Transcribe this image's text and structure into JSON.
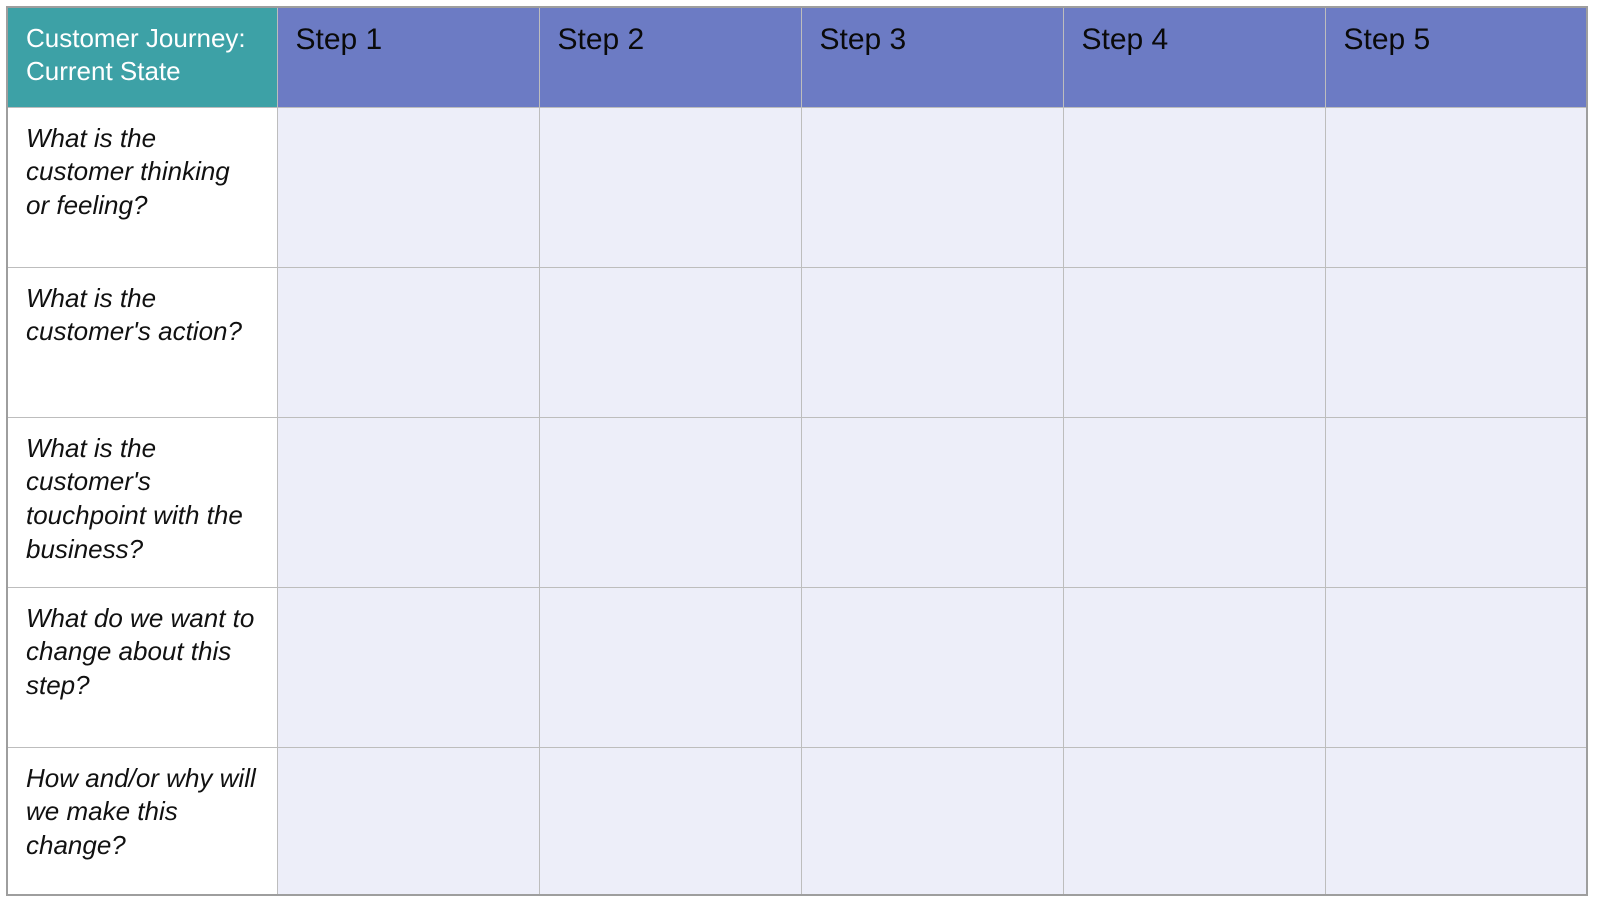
{
  "chart_data": {
    "type": "table",
    "title": "Customer Journey: Current State",
    "columns": [
      "Step 1",
      "Step 2",
      "Step 3",
      "Step 4",
      "Step 5"
    ],
    "rows": [
      "What is the customer thinking or feeling?",
      "What is the customer's action?",
      "What is the customer's touchpoint with the business?",
      "What do we want to change about this step?",
      "How and/or why will we make this change?"
    ],
    "cells": [
      [
        "",
        "",
        "",
        "",
        ""
      ],
      [
        "",
        "",
        "",
        "",
        ""
      ],
      [
        "",
        "",
        "",
        "",
        ""
      ],
      [
        "",
        "",
        "",
        "",
        ""
      ],
      [
        "",
        "",
        "",
        "",
        ""
      ]
    ]
  },
  "table": {
    "corner_label": "Customer Journey: Current State",
    "steps": [
      "Step 1",
      "Step 2",
      "Step 3",
      "Step 4",
      "Step 5"
    ],
    "row_labels": [
      "What is the customer thinking or feeling?",
      "What is the customer's action?",
      "What is the customer's touchpoint with the business?",
      "What do we want to change about this step?",
      "How and/or why will we make this change?"
    ],
    "cells": {
      "r0": [
        "",
        "",
        "",
        "",
        ""
      ],
      "r1": [
        "",
        "",
        "",
        "",
        ""
      ],
      "r2": [
        "",
        "",
        "",
        "",
        ""
      ],
      "r3": [
        "",
        "",
        "",
        "",
        ""
      ],
      "r4": [
        "",
        "",
        "",
        "",
        ""
      ]
    }
  },
  "colors": {
    "corner_bg": "#3da1a6",
    "step_bg": "#6c7bc4",
    "cell_bg": "#edeef9",
    "border": "#bdbdbd"
  }
}
